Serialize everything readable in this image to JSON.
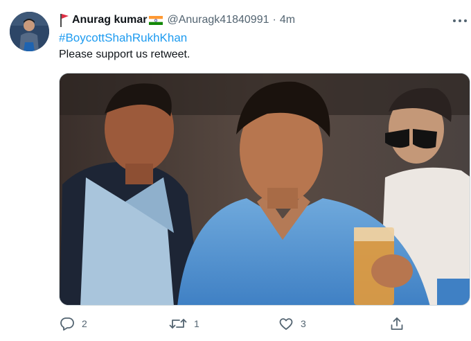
{
  "tweet": {
    "display_name": "Anurag kumar",
    "handle": "@Anuragk41840991",
    "separator": "·",
    "time": "4m",
    "hashtag": "#BoycottShahRukhKhan",
    "text": "Please support us retweet."
  },
  "actions": {
    "reply_count": "2",
    "retweet_count": "1",
    "like_count": "3"
  },
  "icons": {
    "profile_flag": "red-flag-icon",
    "name_badge": "india-flag-icon",
    "more": "more-icon",
    "reply": "reply-icon",
    "retweet": "retweet-icon",
    "like": "heart-icon",
    "share": "share-icon"
  },
  "colors": {
    "link": "#1d9bf0",
    "secondary_text": "#536471",
    "primary_text": "#0f1419"
  }
}
